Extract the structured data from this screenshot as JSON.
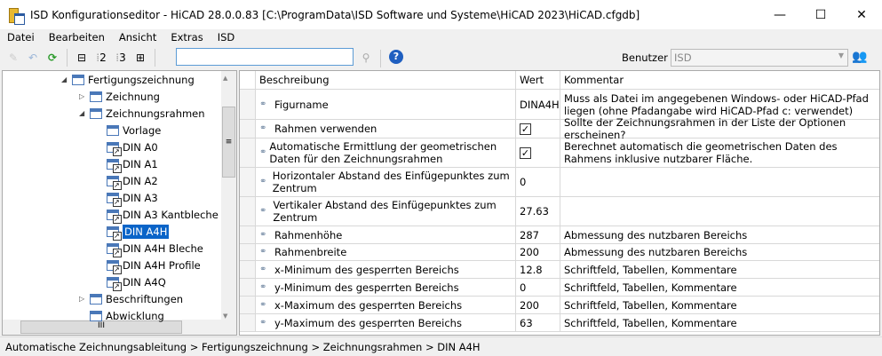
{
  "window": {
    "title": "ISD Konfigurationseditor  - HiCAD 28.0.0.83 [C:\\ProgramData\\ISD Software und Systeme\\HiCAD 2023\\HiCAD.cfgdb]"
  },
  "menu": [
    "Datei",
    "Bearbeiten",
    "Ansicht",
    "Extras",
    "ISD"
  ],
  "toolbar": {
    "search_value": "",
    "user_label": "Benutzer",
    "user_value": "ISD",
    "level2": "2",
    "level3": "3"
  },
  "tree": [
    {
      "label": "Fertigungszeichnung",
      "level": 0,
      "expander": "expanded",
      "icon": "table"
    },
    {
      "label": "Zeichnung",
      "level": 1,
      "expander": "collapsed",
      "icon": "table"
    },
    {
      "label": "Zeichnungsrahmen",
      "level": 1,
      "expander": "expanded",
      "icon": "table"
    },
    {
      "label": "Vorlage",
      "level": 2,
      "icon": "table"
    },
    {
      "label": "DIN A0",
      "level": 2,
      "icon": "table-link"
    },
    {
      "label": "DIN A1",
      "level": 2,
      "icon": "table-link"
    },
    {
      "label": "DIN A2",
      "level": 2,
      "icon": "table-link"
    },
    {
      "label": "DIN A3",
      "level": 2,
      "icon": "table-link"
    },
    {
      "label": "DIN A3 Kantbleche",
      "level": 2,
      "icon": "table-link"
    },
    {
      "label": "DIN A4H",
      "level": 2,
      "icon": "table-link",
      "selected": true
    },
    {
      "label": "DIN A4H Bleche",
      "level": 2,
      "icon": "table-link"
    },
    {
      "label": "DIN A4H Profile",
      "level": 2,
      "icon": "table-link"
    },
    {
      "label": "DIN A4Q",
      "level": 2,
      "icon": "table-link"
    },
    {
      "label": "Beschriftungen",
      "level": 1,
      "expander": "collapsed",
      "icon": "table"
    },
    {
      "label": "Abwicklung",
      "level": 1,
      "icon": "table"
    }
  ],
  "grid": {
    "headers": [
      "Beschreibung",
      "Wert",
      "Kommentar"
    ],
    "rows": [
      {
        "desc": "Figurname",
        "value": "DINA4H",
        "comment": "Muss als Datei im angegebenen Windows- oder HiCAD-Pfad liegen (ohne Pfadangabe wird HiCAD-Pfad c: verwendet)"
      },
      {
        "desc": "Rahmen verwenden",
        "checked": true,
        "comment": "Sollte der Zeichnungsrahmen in der Liste der Optionen erscheinen?"
      },
      {
        "desc": "Automatische Ermittlung der geometrischen Daten für den Zeichnungsrahmen",
        "checked": true,
        "comment": "Berechnet automatisch die geometrischen Daten des Rahmens inklusive nutzbarer Fläche."
      },
      {
        "desc": "Horizontaler Abstand des Einfügepunktes zum Zentrum",
        "value": "0",
        "comment": ""
      },
      {
        "desc": "Vertikaler Abstand des Einfügepunktes zum Zentrum",
        "value": "27.63",
        "comment": ""
      },
      {
        "desc": "Rahmenhöhe",
        "value": "287",
        "comment": "Abmessung des nutzbaren Bereichs"
      },
      {
        "desc": "Rahmenbreite",
        "value": "200",
        "comment": "Abmessung des nutzbaren Bereichs"
      },
      {
        "desc": "x-Minimum des gesperrten Bereichs",
        "value": "12.8",
        "comment": "Schriftfeld, Tabellen, Kommentare"
      },
      {
        "desc": "y-Minimum des gesperrten Bereichs",
        "value": "0",
        "comment": "Schriftfeld, Tabellen, Kommentare"
      },
      {
        "desc": "x-Maximum des gesperrten Bereichs",
        "value": "200",
        "comment": "Schriftfeld, Tabellen, Kommentare"
      },
      {
        "desc": "y-Maximum des gesperrten Bereichs",
        "value": "63",
        "comment": "Schriftfeld, Tabellen, Kommentare"
      }
    ]
  },
  "status": "Automatische Zeichnungsableitung > Fertigungszeichnung > Zeichnungsrahmen > DIN A4H"
}
